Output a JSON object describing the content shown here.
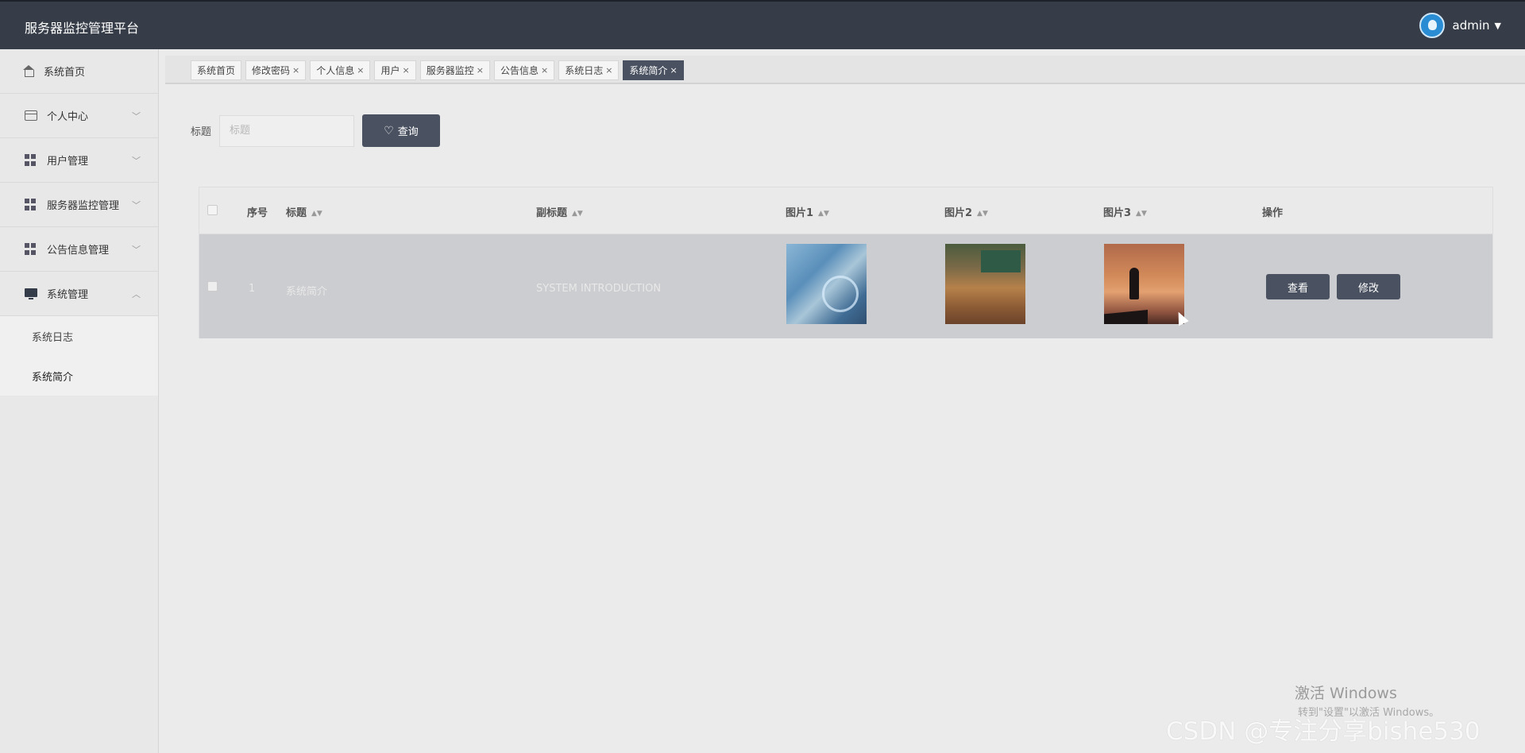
{
  "header": {
    "app_title": "服务器监控管理平台",
    "user_name": "admin"
  },
  "sidebar": {
    "items": [
      {
        "label": "系统首页",
        "icon": "home-icon"
      },
      {
        "label": "个人中心",
        "icon": "id-card-icon"
      },
      {
        "label": "用户管理",
        "icon": "grid-icon"
      },
      {
        "label": "服务器监控管理",
        "icon": "grid-icon"
      },
      {
        "label": "公告信息管理",
        "icon": "grid-icon"
      },
      {
        "label": "系统管理",
        "icon": "monitor-icon"
      }
    ],
    "submenu": [
      {
        "label": "系统日志"
      },
      {
        "label": "系统简介"
      }
    ]
  },
  "tabs": [
    {
      "label": "系统首页"
    },
    {
      "label": "修改密码"
    },
    {
      "label": "个人信息"
    },
    {
      "label": "用户"
    },
    {
      "label": "服务器监控"
    },
    {
      "label": "公告信息"
    },
    {
      "label": "系统日志"
    },
    {
      "label": "系统简介"
    }
  ],
  "search": {
    "label": "标题",
    "placeholder": "标题",
    "button_label": "查询"
  },
  "table": {
    "columns": [
      "序号",
      "标题",
      "副标题",
      "图片1",
      "图片2",
      "图片3",
      "操作"
    ],
    "rows": [
      {
        "index": "1",
        "title": "系统简介",
        "subtitle": "SYSTEM INTRODUCTION",
        "view_label": "查看",
        "edit_label": "修改"
      }
    ]
  },
  "watermarks": {
    "windows_title": "激活 Windows",
    "windows_sub": "转到\"设置\"以激活 Windows。",
    "csdn": "CSDN @专注分享bishe530"
  },
  "colors": {
    "topbar": "#363d48",
    "accent_button": "#4a5160",
    "selected_row": "#cccdd0"
  }
}
